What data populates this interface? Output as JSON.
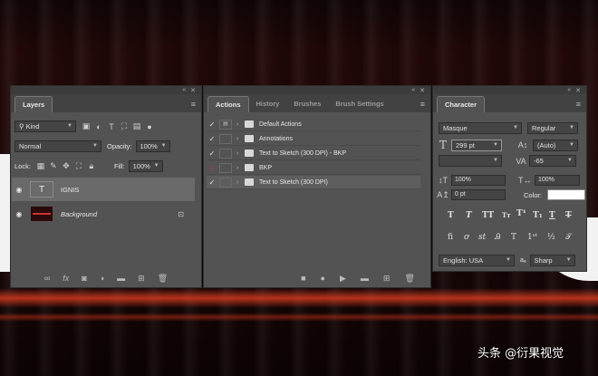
{
  "layers_panel": {
    "tab": "Layers",
    "filter_select": "Kind",
    "blend_mode": "Normal",
    "opacity_label": "Opacity:",
    "opacity_value": "100%",
    "lock_label": "Lock:",
    "fill_label": "Fill:",
    "fill_value": "100%",
    "layers": [
      {
        "name": "IGNIS",
        "type": "text"
      },
      {
        "name": "Background",
        "type": "image"
      }
    ],
    "fx_label": "fx"
  },
  "actions_panel": {
    "tabs": [
      "Actions",
      "History",
      "Brushes",
      "Brush Settings"
    ],
    "actions": [
      {
        "name": "Default Actions"
      },
      {
        "name": "Annotations"
      },
      {
        "name": "Text to Sketch (300 DPI) - BKP"
      },
      {
        "name": "BKP"
      },
      {
        "name": "Text to Sketch (300 DPI)"
      }
    ]
  },
  "character_panel": {
    "tab": "Character",
    "font_family": "Masque",
    "font_style": "Regular",
    "font_size": "299 pt",
    "leading": "(Auto)",
    "kerning_value": "",
    "tracking": "-65",
    "vertical_scale": "100%",
    "horizontal_scale": "100%",
    "baseline_shift": "0 pt",
    "color_label": "Color:",
    "color": "#ffffff",
    "language": "English: USA",
    "antialias_label": "a",
    "antialias": "Sharp"
  },
  "watermark": "头条 @衍果视觉"
}
